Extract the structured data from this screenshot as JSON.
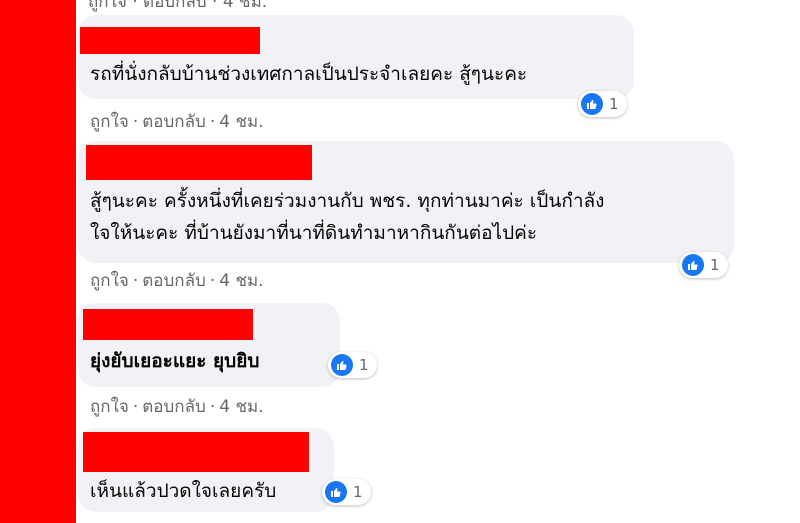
{
  "top_partial_actions": "ถูกใจ · ตอบกลับ · 4 ชม.",
  "comments": [
    {
      "text_lines": [
        "รถที่นั่งกลับบ้านช่วงเทศกาลเป็นประจำเลยคะ สู้ๆนะคะ"
      ],
      "bold": false,
      "reaction_count": "1",
      "actions": {
        "like": "ถูกใจ",
        "reply": "ตอบกลับ",
        "time": "4 ชม."
      }
    },
    {
      "text_lines": [
        "สู้ๆนะคะ ครั้งหนึ่งที่เคยร่วมงานกับ พชร. ทุกท่านมาค่ะ เป็นกำลัง",
        "ใจให้นะคะ ที่บ้านยังมาที่นาที่ดินทำมาหากินกันต่อไปค่ะ"
      ],
      "bold": false,
      "reaction_count": "1",
      "actions": {
        "like": "ถูกใจ",
        "reply": "ตอบกลับ",
        "time": "4 ชม."
      }
    },
    {
      "text_lines": [
        "ยุ่งยับเยอะแยะ ยุบยิบ"
      ],
      "bold": true,
      "reaction_count": "1",
      "actions": {
        "like": "ถูกใจ",
        "reply": "ตอบกลับ",
        "time": "4 ชม."
      }
    },
    {
      "text_lines": [
        "เห็นแล้วปวดใจเลยครับ"
      ],
      "bold": false,
      "reaction_count": "1",
      "actions": null
    }
  ],
  "colors": {
    "redaction": "#ff0000",
    "bubble": "#f0f2f5",
    "like_blue": "#1877f2",
    "meta_gray": "#65676b"
  }
}
